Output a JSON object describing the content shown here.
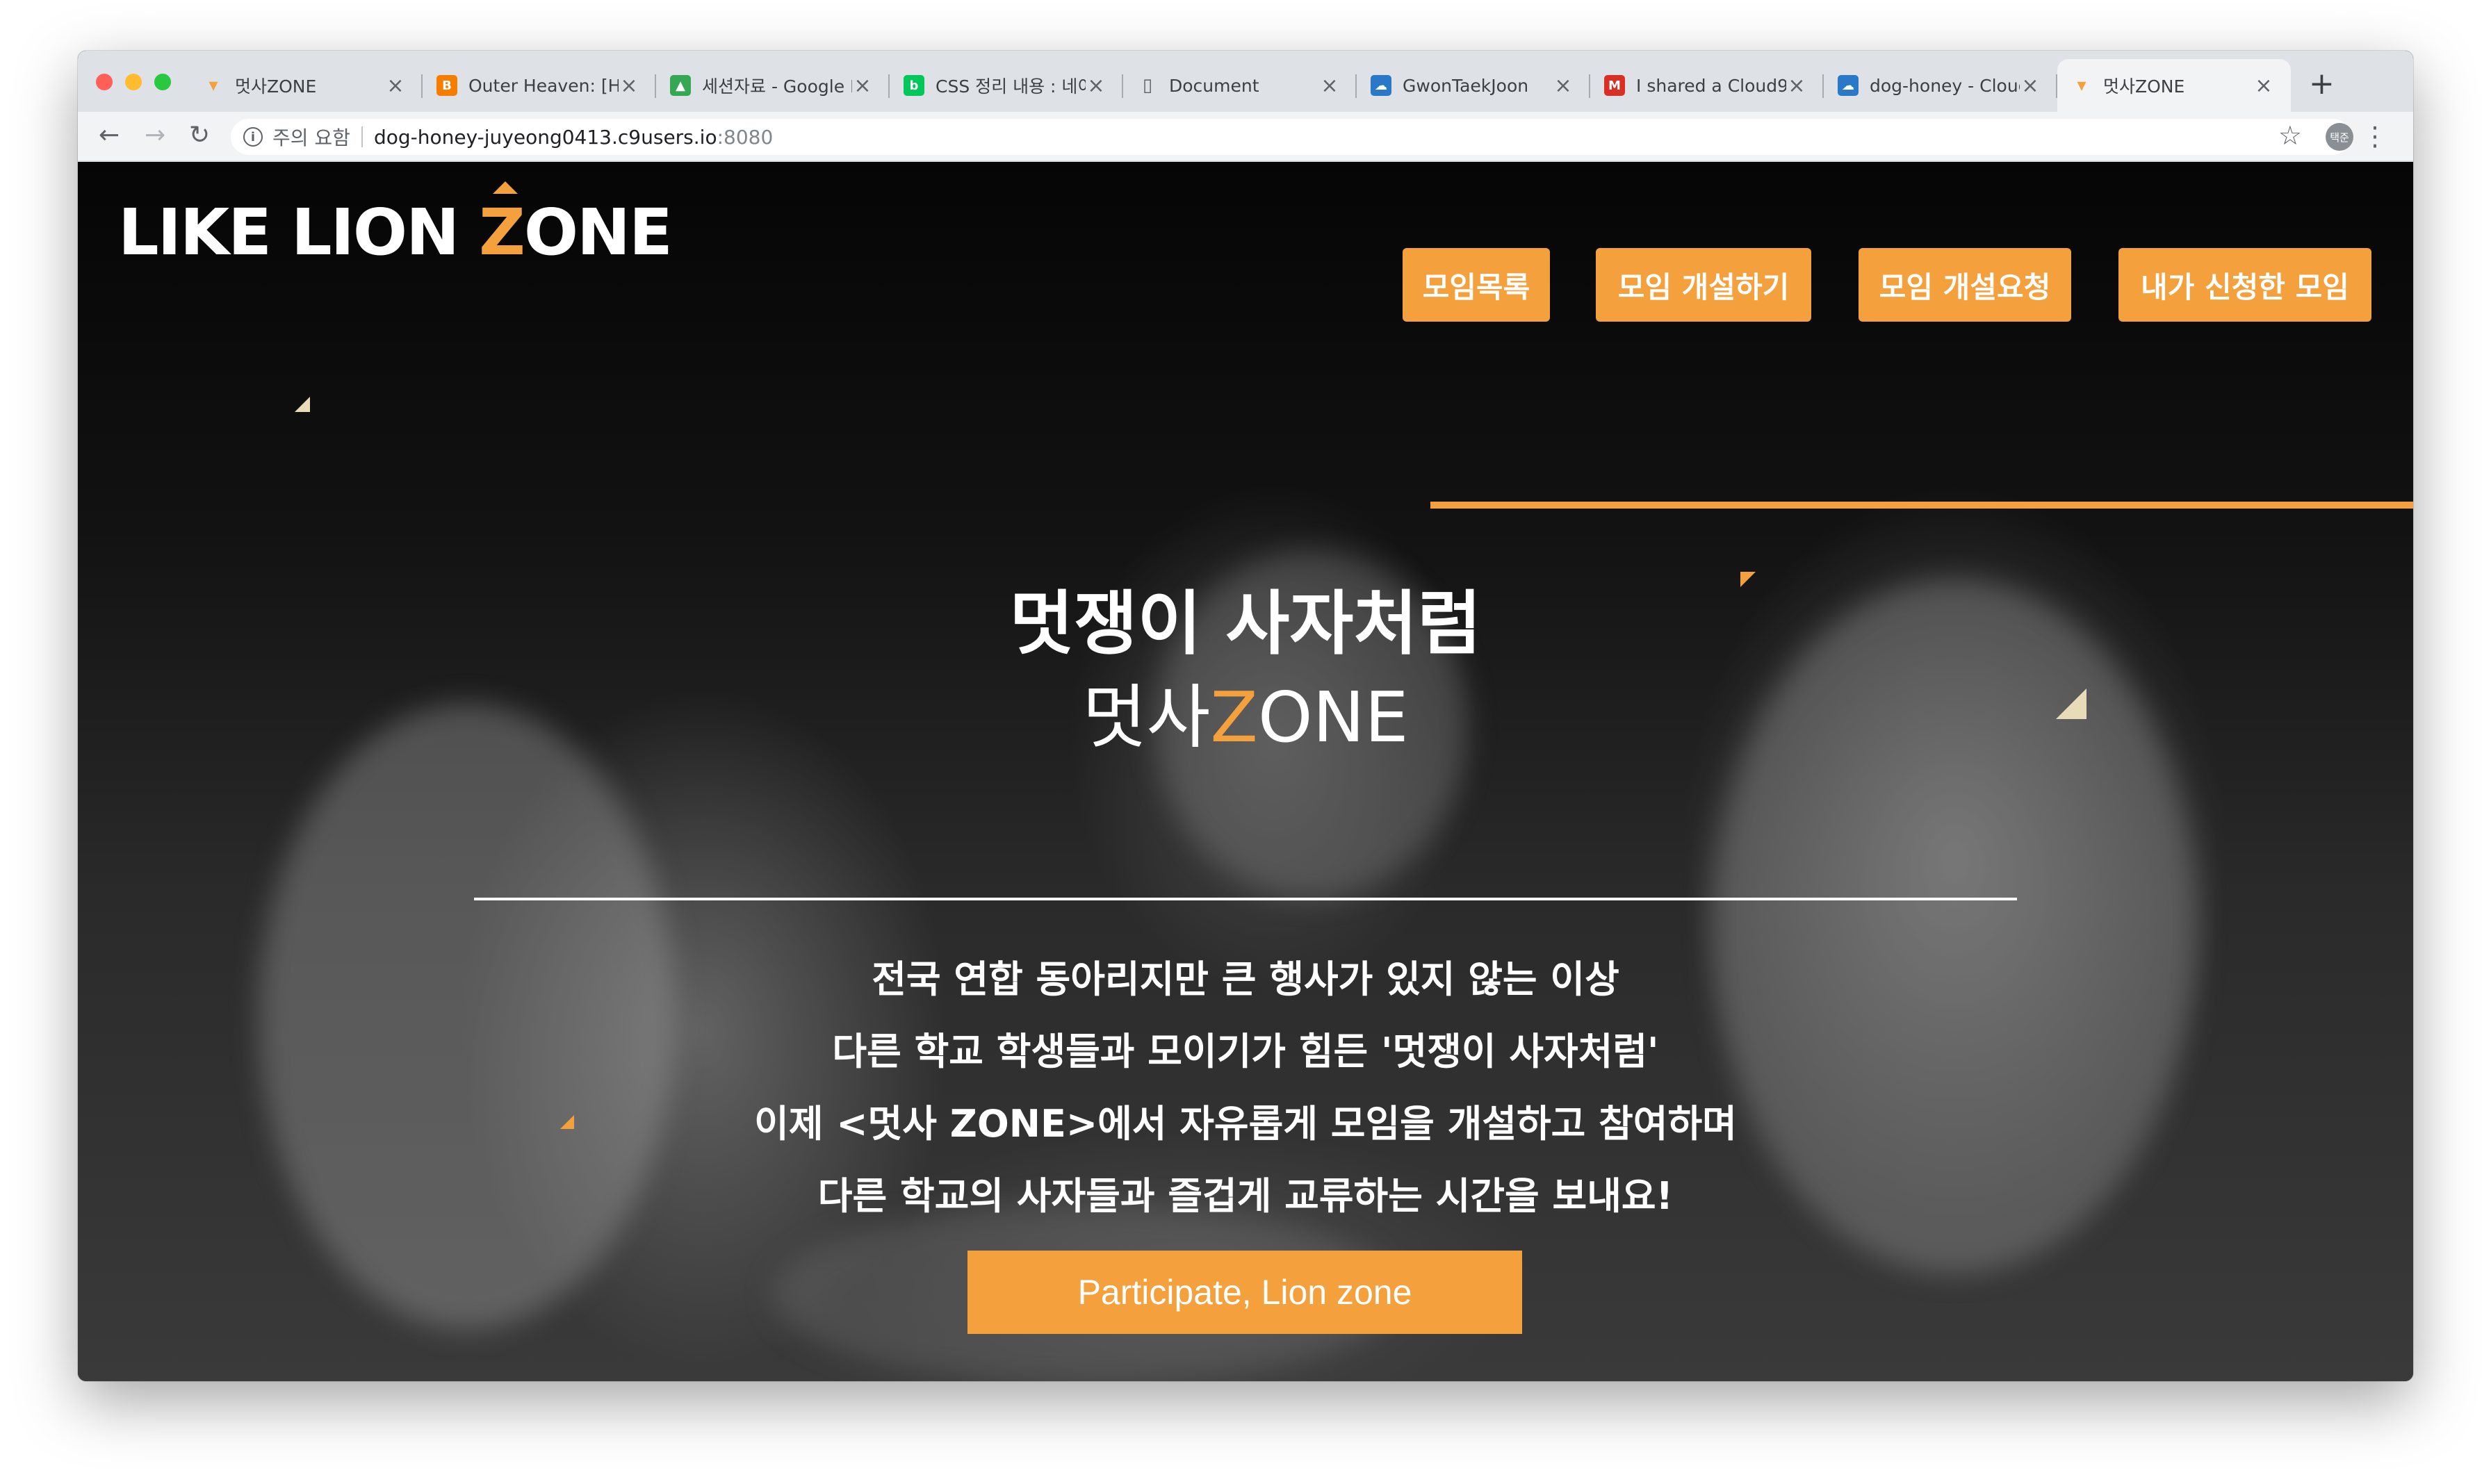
{
  "browser": {
    "tabs": [
      {
        "title": "멋사ZONE",
        "favicon": "lion-logo-icon",
        "color": "#f3a03d",
        "active": false
      },
      {
        "title": "Outer Heaven: [HT",
        "favicon": "blogger-icon",
        "color": "#f57d00",
        "active": false
      },
      {
        "title": "세션자료 - Google D",
        "favicon": "google-drive-icon",
        "color": "#34a853",
        "active": false
      },
      {
        "title": "CSS 정리 내용 : 네이",
        "favicon": "naver-blog-icon",
        "color": "#03c75a",
        "active": false
      },
      {
        "title": "Document",
        "favicon": "document-icon",
        "color": "#5f6368",
        "active": false
      },
      {
        "title": "GwonTaekJoon",
        "favicon": "cloud9-icon",
        "color": "#2979c8",
        "active": false
      },
      {
        "title": "I shared a Cloud9",
        "favicon": "gmail-icon",
        "color": "#d93025",
        "active": false
      },
      {
        "title": "dog-honey - Cloud",
        "favicon": "cloud9-icon",
        "color": "#2979c8",
        "active": false
      },
      {
        "title": "멋사ZONE",
        "favicon": "lion-logo-icon",
        "color": "#f3a03d",
        "active": true
      }
    ],
    "new_tab": "+",
    "security_label": "주의 요함",
    "url_host": "dog-honey-juyeong0413.c9users.io",
    "url_port": ":8080",
    "profile_initials": "택준"
  },
  "site": {
    "logo_prefix": "LIKE LION ",
    "logo_z": "Z",
    "logo_suffix": "ONE",
    "menu": [
      "모임목록",
      "모임 개설하기",
      "모임 개설요청",
      "내가 신청한 모임"
    ],
    "hero_title": "멋쟁이 사자처럼",
    "hero_sub_prefix": "멋사",
    "hero_sub_z": "Z",
    "hero_sub_suffix": "ONE",
    "description": [
      "전국 연합 동아리지만 큰 행사가 있지 않는 이상",
      "다른 학교 학생들과 모이기가 힘든 '멋쟁이 사자처럼'",
      "이제 <멋사 ZONE>에서 자유롭게 모임을 개설하고 참여하며",
      "다른 학교의 사자들과 즐겁게 교류하는 시간을 보내요!"
    ],
    "cta_label": "Participate, Lion zone"
  },
  "colors": {
    "accent": "#f3a03d",
    "background": "#000000"
  }
}
